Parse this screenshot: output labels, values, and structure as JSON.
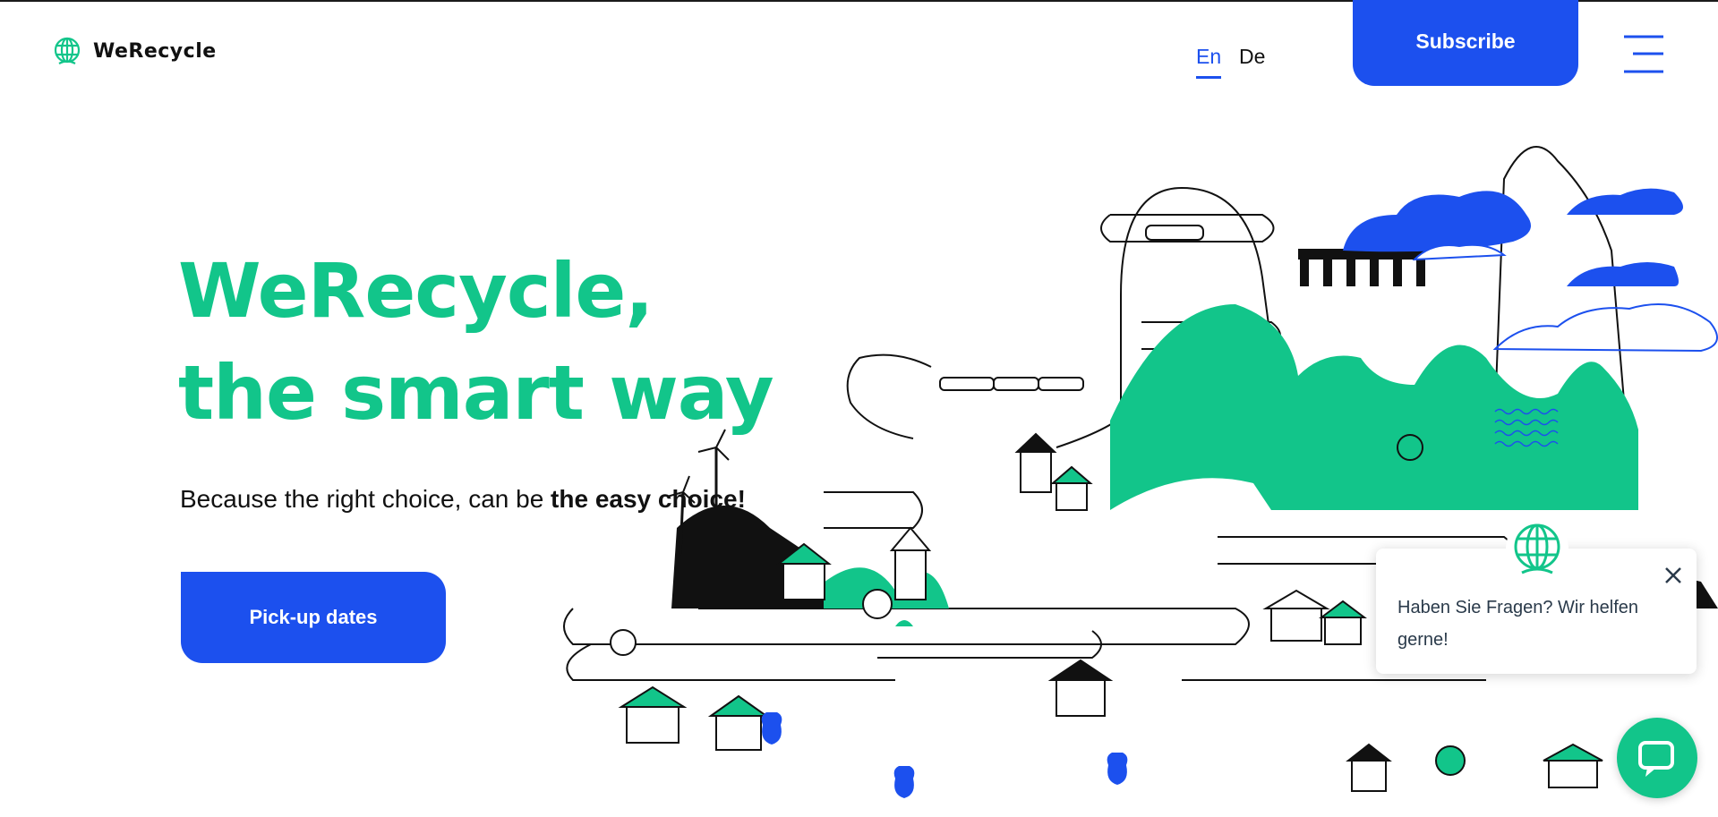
{
  "header": {
    "brand": "WeRecycle",
    "languages": [
      "En",
      "De"
    ],
    "active_language": "En",
    "subscribe_label": "Subscribe"
  },
  "hero": {
    "title_line1": "WeRecycle,",
    "title_line2": "the smart way",
    "subtitle_prefix": "Because the right choice, can be ",
    "subtitle_emphasis": "the easy choice!",
    "cta_label": "Pick-up dates"
  },
  "chat": {
    "message": "Haben Sie Fragen? Wir helfen gerne!"
  },
  "colors": {
    "brand_green": "#12c58a",
    "brand_blue": "#1c50ee"
  },
  "icons": [
    "globe-icon",
    "hamburger-menu-icon",
    "close-icon",
    "chat-bubble-icon"
  ]
}
